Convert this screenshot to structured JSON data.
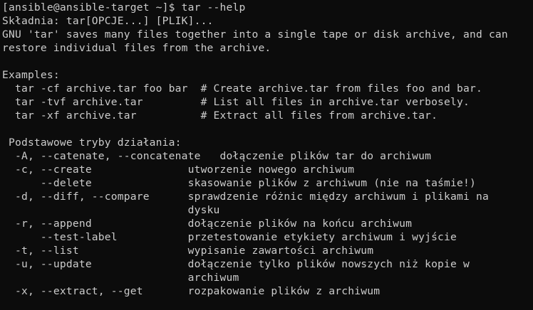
{
  "terminal": {
    "lines": [
      "[ansible@ansible-target ~]$ tar --help",
      "Składnia: tar[OPCJE...] [PLIK]...",
      "GNU 'tar' saves many files together into a single tape or disk archive, and can",
      "restore individual files from the archive.",
      "",
      "Examples:",
      "  tar -cf archive.tar foo bar  # Create archive.tar from files foo and bar.",
      "  tar -tvf archive.tar         # List all files in archive.tar verbosely.",
      "  tar -xf archive.tar          # Extract all files from archive.tar.",
      "",
      " Podstawowe tryby działania:",
      "  -A, --catenate, --concatenate   dołączenie plików tar do archiwum",
      "  -c, --create               utworzenie nowego archiwum",
      "      --delete               skasowanie plików z archiwum (nie na taśmie!)",
      "  -d, --diff, --compare      sprawdzenie różnic między archiwum i plikami na",
      "                             dysku",
      "  -r, --append               dołączenie plików na końcu archiwum",
      "      --test-label           przetestowanie etykiety archiwum i wyjście",
      "  -t, --list                 wypisanie zawartości archiwum",
      "  -u, --update               dołączenie tylko plików nowszych niż kopie w",
      "                             archiwum",
      "  -x, --extract, --get       rozpakowanie plików z archiwum"
    ]
  },
  "colors": {
    "background": "#0c0c0c",
    "foreground": "#cccccc"
  }
}
